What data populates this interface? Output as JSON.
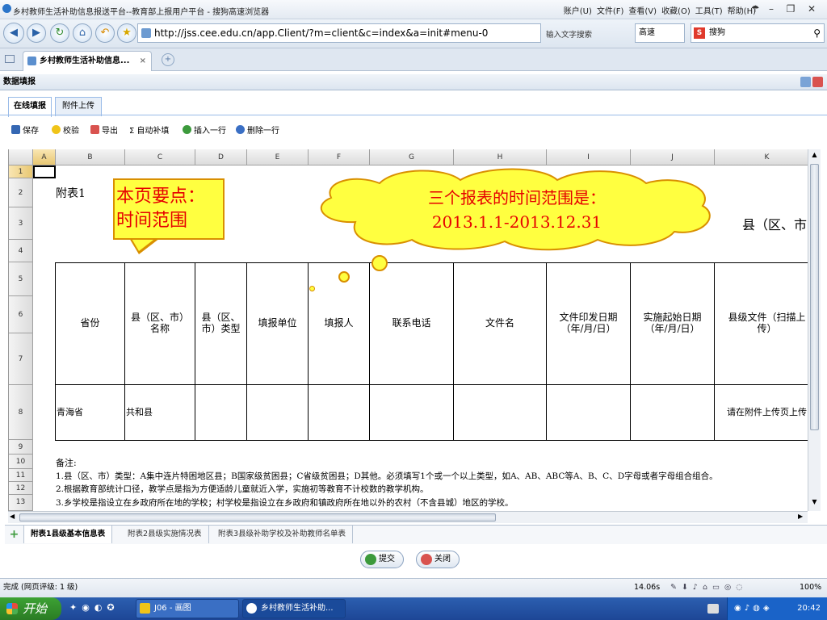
{
  "browser": {
    "title": "乡村教师生活补助信息报送平台--教育部上报用户平台 - 搜狗高速浏览器",
    "menu": [
      "账户(U)",
      "文件(F)",
      "查看(V)",
      "收藏(O)",
      "工具(T)",
      "帮助(H)"
    ],
    "url": "http://jss.cee.edu.cn/app.Client/?m=client&c=index&a=init#menu-0",
    "search_hint": "输入文字搜索",
    "speed_mode": "高速",
    "search_engine": "搜狗",
    "tab_title": "乡村教师生活补助信息...",
    "tab_close": "×"
  },
  "panel": {
    "title": "数据填报",
    "tabs": [
      "在线填报",
      "附件上传"
    ]
  },
  "toolbar": {
    "save": "保存",
    "check": "校验",
    "export": "导出",
    "autofill": "自动补填",
    "insert_row": "插入一行",
    "delete_row": "删除一行"
  },
  "grid": {
    "columns": [
      "A",
      "B",
      "C",
      "D",
      "E",
      "F",
      "G",
      "H",
      "I",
      "J",
      "K"
    ],
    "rows": [
      "1",
      "2",
      "3",
      "4",
      "5",
      "6",
      "7",
      "8",
      "9",
      "10",
      "11",
      "12",
      "13"
    ],
    "title_cell": "附表1",
    "county_header_partial": "县（区、市",
    "headers": {
      "province": "省份",
      "county_name": "县（区、市）\n名称",
      "county_type": "县（区、\n市）类型",
      "unit": "填报单位",
      "reporter": "填报人",
      "phone": "联系电话",
      "doc_name": "文件名",
      "issue_date": "文件印发日期\n（年/月/日）",
      "start_date": "实施起始日期\n（年/月/日）",
      "county_doc": "县级文件（扫描上\n传）"
    },
    "data_row": {
      "province": "青海省",
      "county": "共和县",
      "upload_note": "请在附件上传页上传"
    },
    "notes": [
      "备注:",
      "1.县（区、市）类型：A集中连片特困地区县；B国家级贫困县；C省级贫困县；D其他。必须填写1个或一个以上类型，如A、AB、ABC等A、B、C、D字母或者字母组合组合。",
      "2.根据教育部统计口径，教学点是指为方便适龄儿童就近入学，实施初等教育不计校数的教学机构。",
      "3.乡学校是指设立在乡政府所在地的学校；村学校是指设立在乡政府和镇政府所在地以外的农村（不含县城）地区的学校。"
    ]
  },
  "sheet_tabs": [
    "附表1县级基本信息表",
    "附表2县级实施情况表",
    "附表3县级补助学校及补助教师名单表"
  ],
  "buttons": {
    "submit": "提交",
    "close": "关闭"
  },
  "status": {
    "left": "完成 (网页评级: 1 级)",
    "time": "14.06s",
    "zoom": "100%"
  },
  "taskbar": {
    "start": "开始",
    "tasks": [
      "J06 - 画图",
      "乡村教师生活补助..."
    ],
    "clock": "20:42"
  },
  "callouts": {
    "note1": "本页要点：\n时间范围",
    "note2": "三个报表的时间范围是：\n2013.1.1-2013.12.31"
  },
  "colors": {
    "callout_fill": "#ffff40",
    "callout_text": "#e60000",
    "callout_border": "#d98f00",
    "tab_border": "#99bbe8"
  }
}
